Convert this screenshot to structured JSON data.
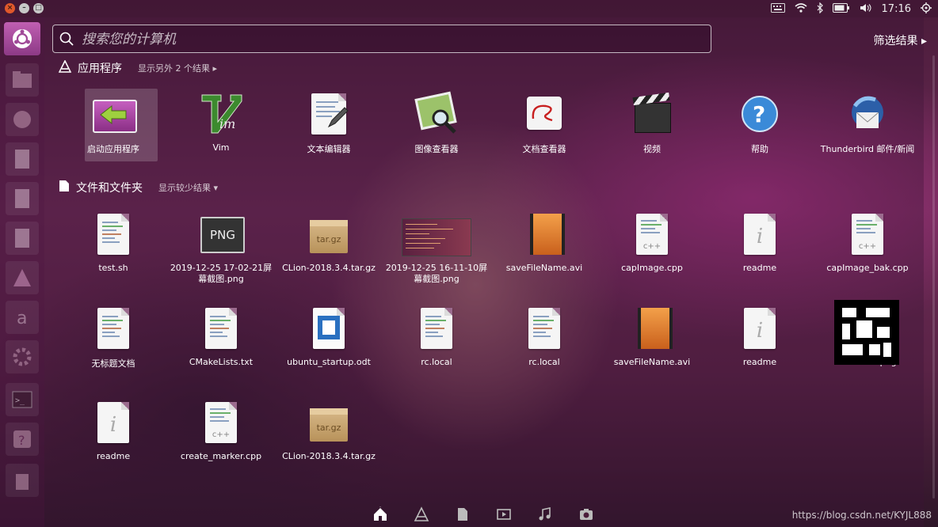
{
  "panel": {
    "clock": "17:16",
    "window_controls": [
      "close",
      "minimize",
      "maximize"
    ],
    "tray_icons": [
      "keyboard-icon",
      "wifi-icon",
      "bluetooth-icon",
      "battery-icon",
      "volume-icon",
      "power-icon"
    ]
  },
  "launcher": {
    "items": [
      "dash-home-icon",
      "files-icon",
      "update-icon",
      "writer-icon",
      "calc-icon",
      "impress-icon",
      "software-center-icon",
      "amazon-icon",
      "settings-icon",
      "terminal-icon",
      "help-icon",
      "trash-icon"
    ]
  },
  "search": {
    "placeholder": "搜索您的计算机",
    "value": ""
  },
  "filter_label": "筛选结果 ▸",
  "apps_section": {
    "title": "应用程序",
    "more": "显示另外 2 个结果 ▸",
    "items": [
      {
        "label": "启动应用程序",
        "icon": "startup-apps-icon"
      },
      {
        "label": "Vim",
        "icon": "vim-icon"
      },
      {
        "label": "文本编辑器",
        "icon": "text-editor-icon"
      },
      {
        "label": "图像查看器",
        "icon": "image-viewer-icon"
      },
      {
        "label": "文档查看器",
        "icon": "document-viewer-icon"
      },
      {
        "label": "视频",
        "icon": "video-icon"
      },
      {
        "label": "帮助",
        "icon": "help-icon"
      },
      {
        "label": "Thunderbird 邮件/新闻",
        "icon": "thunderbird-icon"
      }
    ]
  },
  "files_section": {
    "title": "文件和文件夹",
    "more": "显示较少结果 ▾",
    "items": [
      {
        "label": "test.sh",
        "icon": "script-file-icon"
      },
      {
        "label": "2019-12-25 17-02-21屏幕截图.png",
        "icon": "png-file-icon"
      },
      {
        "label": "CLion-2018.3.4.tar.gz",
        "icon": "archive-icon"
      },
      {
        "label": "2019-12-25 16-11-10屏幕截图.png",
        "icon": "screenshot-thumb-icon"
      },
      {
        "label": "saveFileName.avi",
        "icon": "video-file-icon"
      },
      {
        "label": "capImage.cpp",
        "icon": "cpp-file-icon"
      },
      {
        "label": "readme",
        "icon": "info-file-icon"
      },
      {
        "label": "capImage_bak.cpp",
        "icon": "cpp-file-icon"
      },
      {
        "label": "无标题文档",
        "icon": "text-file-icon"
      },
      {
        "label": "CMakeLists.txt",
        "icon": "text-file-icon"
      },
      {
        "label": "ubuntu_startup.odt",
        "icon": "odt-file-icon"
      },
      {
        "label": "rc.local",
        "icon": "script-file-icon"
      },
      {
        "label": "rc.local",
        "icon": "script-file-icon"
      },
      {
        "label": "saveFileName.avi",
        "icon": "video-file-icon"
      },
      {
        "label": "readme",
        "icon": "info-file-icon"
      },
      {
        "label": "maker14.png",
        "icon": "marker-image-icon"
      },
      {
        "label": "readme",
        "icon": "info-file-icon"
      },
      {
        "label": "create_marker.cpp",
        "icon": "cpp-file-icon"
      },
      {
        "label": "CLion-2018.3.4.tar.gz",
        "icon": "archive-icon"
      }
    ]
  },
  "lenses": [
    "home-lens-icon",
    "apps-lens-icon",
    "files-lens-icon",
    "video-lens-icon",
    "music-lens-icon",
    "photo-lens-icon"
  ],
  "watermark": "https://blog.csdn.net/KYJL888"
}
